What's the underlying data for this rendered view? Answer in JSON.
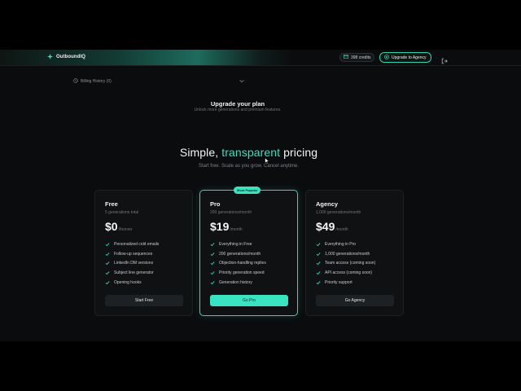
{
  "app": {
    "name": "OutboundIQ"
  },
  "header": {
    "credits_label": "398 credits",
    "upgrade_label": "Upgrade to Agency"
  },
  "billing": {
    "label": "Billing History (0)"
  },
  "upgrade": {
    "title": "Upgrade your plan",
    "subtitle": "Unlock more generations and premium features."
  },
  "hero": {
    "title_prefix": "Simple, ",
    "title_accent": "transparent",
    "title_suffix": " pricing",
    "subtitle": "Start free. Scale as you grow. Cancel anytime."
  },
  "plans": [
    {
      "name": "Free",
      "desc": "5 generations total",
      "amount": "$0",
      "period": "/forever",
      "features": [
        "Personalized cold emails",
        "Follow-up sequences",
        "LinkedIn DM versions",
        "Subject line generator",
        "Opening hooks"
      ],
      "cta": "Start Free"
    },
    {
      "name": "Pro",
      "badge": "Most Popular",
      "desc": "200 generations/month",
      "amount": "$19",
      "period": "/month",
      "features": [
        "Everything in Free",
        "200 generations/month",
        "Objection-handling replies",
        "Priority generation speed",
        "Generation history"
      ],
      "cta": "Go Pro"
    },
    {
      "name": "Agency",
      "desc": "1,000 generations/month",
      "amount": "$49",
      "period": "/month",
      "features": [
        "Everything in Pro",
        "1,000 generations/month",
        "Team access (coming soon)",
        "API access (coming soon)",
        "Priority support"
      ],
      "cta": "Go Agency"
    }
  ],
  "colors": {
    "accent": "#36e0bc",
    "background": "#0b0c0e",
    "card": "#0f1113"
  },
  "icons": {
    "logo": "sparkle-icon",
    "credits": "card-icon",
    "upgrade": "crown-icon",
    "logout": "logout-icon",
    "billing": "history-icon",
    "billing_toggle": "chevron-down-icon",
    "feature": "check-icon"
  }
}
